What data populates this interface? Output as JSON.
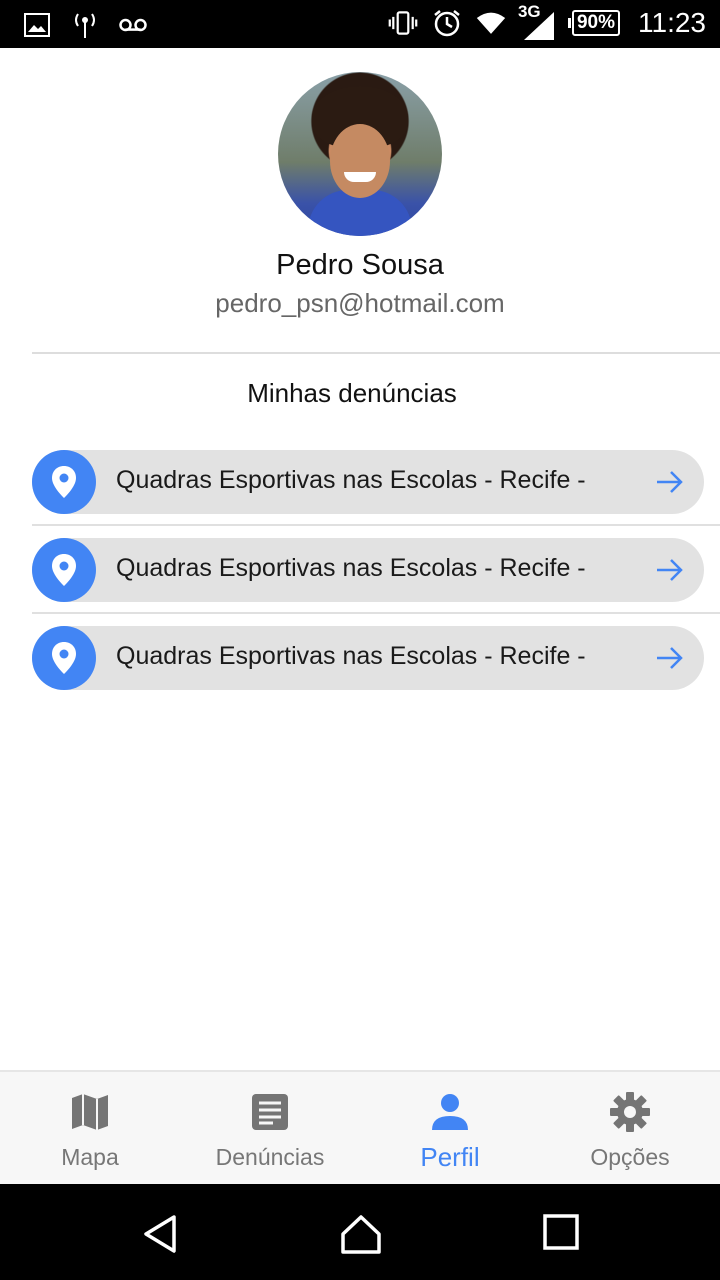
{
  "status_bar": {
    "network": "3G",
    "battery": "90%",
    "time": "11:23",
    "icons": [
      "image-icon",
      "antenna-icon",
      "voicemail-icon",
      "vibrate-icon",
      "alarm-icon",
      "wifi-icon",
      "signal-icon",
      "battery-icon"
    ]
  },
  "profile": {
    "name": "Pedro Sousa",
    "email": "pedro_psn@hotmail.com"
  },
  "reports": {
    "title": "Minhas denúncias",
    "items": [
      {
        "label": "Quadras Esportivas nas Escolas - Recife -"
      },
      {
        "label": "Quadras Esportivas nas Escolas - Recife -"
      },
      {
        "label": "Quadras Esportivas nas Escolas - Recife -"
      }
    ]
  },
  "bottom_nav": {
    "active": "Perfil",
    "accent": "#4285f4",
    "items": [
      {
        "label": "Mapa",
        "icon": "map-icon"
      },
      {
        "label": "Denúncias",
        "icon": "document-icon"
      },
      {
        "label": "Perfil",
        "icon": "person-icon"
      },
      {
        "label": "Opções",
        "icon": "gear-icon"
      }
    ]
  },
  "colors": {
    "accent": "#4285f4",
    "pill_bg": "#e2e2e2"
  }
}
